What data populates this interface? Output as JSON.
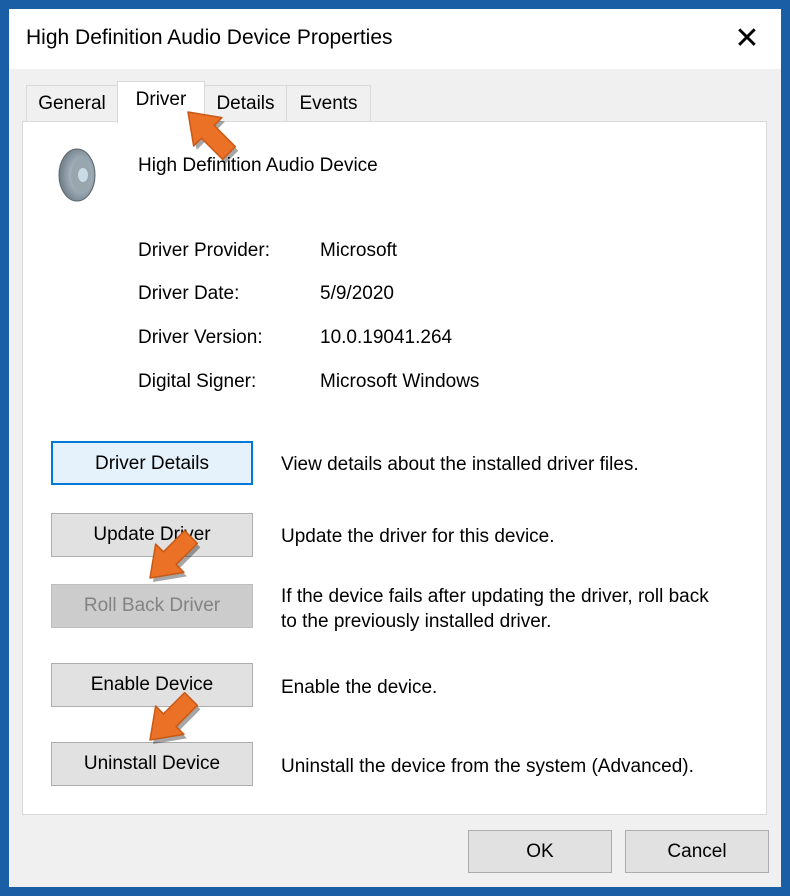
{
  "window": {
    "title": "High Definition Audio Device Properties",
    "close_icon": "close-icon"
  },
  "tabs": [
    {
      "label": "General"
    },
    {
      "label": "Driver",
      "active": true
    },
    {
      "label": "Details"
    },
    {
      "label": "Events"
    }
  ],
  "device": {
    "name": "High Definition Audio Device",
    "icon": "speaker-icon"
  },
  "info": [
    {
      "label": "Driver Provider:",
      "value": "Microsoft"
    },
    {
      "label": "Driver Date:",
      "value": "5/9/2020"
    },
    {
      "label": "Driver Version:",
      "value": "10.0.19041.264"
    },
    {
      "label": "Digital Signer:",
      "value": "Microsoft Windows"
    }
  ],
  "actions": [
    {
      "label": "Driver Details",
      "desc": "View details about the installed driver files."
    },
    {
      "label": "Update Driver",
      "desc": "Update the driver for this device."
    },
    {
      "label": "Roll Back Driver",
      "desc": "If the device fails after updating the driver, roll back to the previously installed driver.",
      "disabled": true
    },
    {
      "label": "Enable Device",
      "desc": "Enable the device."
    },
    {
      "label": "Uninstall Device",
      "desc": "Uninstall the device from the system (Advanced)."
    }
  ],
  "footer": {
    "ok": "OK",
    "cancel": "Cancel"
  },
  "colors": {
    "border": "#1a5fa6",
    "arrow": "#ea7126",
    "focus": "#0078d7"
  }
}
